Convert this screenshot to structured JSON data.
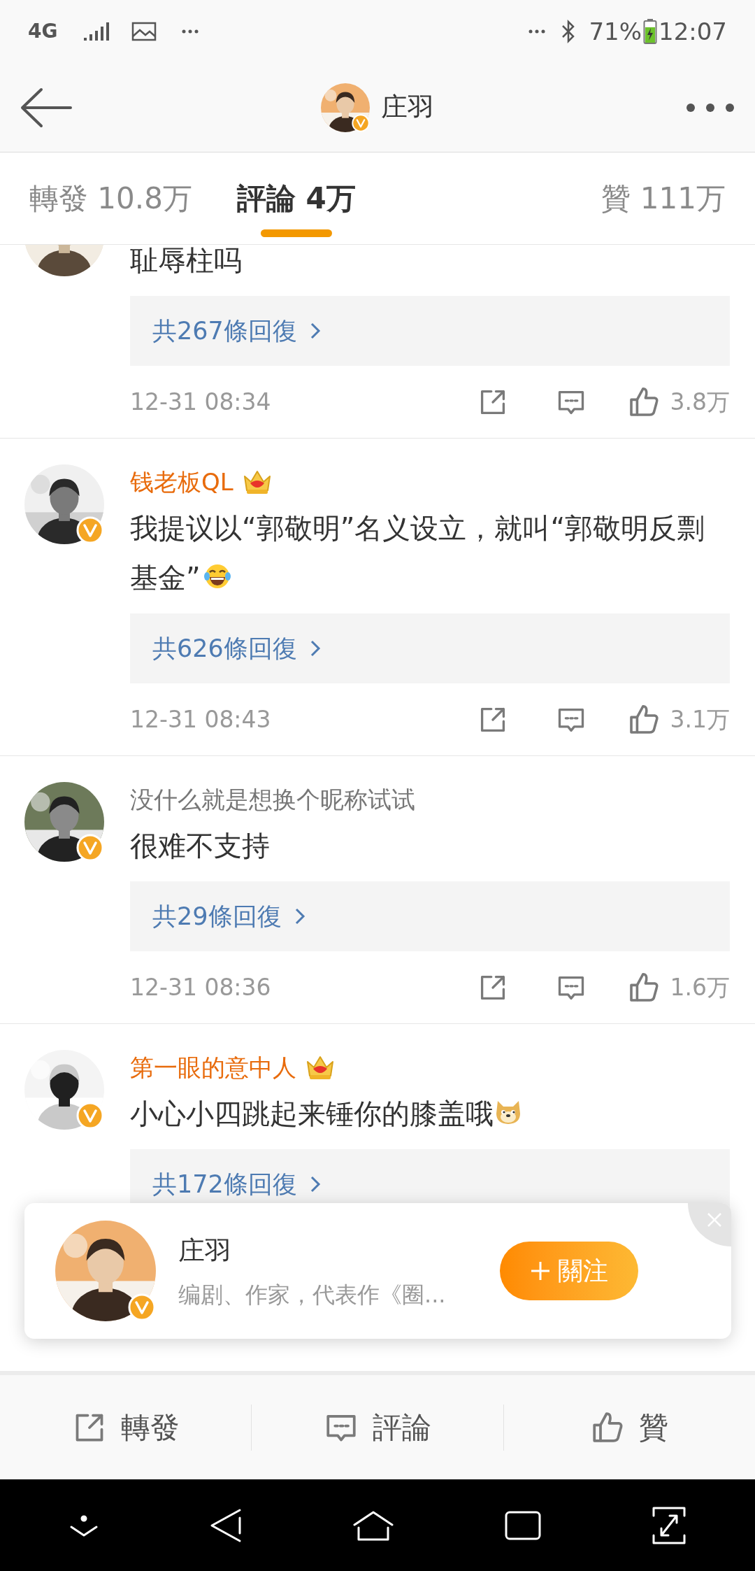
{
  "status_bar": {
    "network": "4G",
    "battery": "71%",
    "time": "12:07"
  },
  "header": {
    "title": "庄羽",
    "verified": true
  },
  "tabs": [
    {
      "label": "轉發",
      "count": "10.8万",
      "selected": false
    },
    {
      "label": "評論",
      "count": "4万",
      "selected": true
    },
    {
      "label": "贊",
      "count": "111万",
      "selected": false
    }
  ],
  "comments": [
    {
      "text": "耻辱柱吗",
      "replies": "共267條回復",
      "date": "12-31 08:34",
      "likes": "3.8万"
    },
    {
      "name": "钱老板QL",
      "vip": true,
      "verified": true,
      "text": "我提议以“郭敬明”名义设立，就叫“郭敬明反剽基金”",
      "replies": "共626條回復",
      "date": "12-31 08:43",
      "likes": "3.1万"
    },
    {
      "name": "没什么就是想换个昵称试试",
      "vip": false,
      "verified": true,
      "text": "很难不支持",
      "replies": "共29條回復",
      "date": "12-31 08:36",
      "likes": "1.6万"
    },
    {
      "name": "第一眼的意中人",
      "vip": true,
      "verified": true,
      "text": "小心小四跳起来锤你的膝盖哦",
      "replies": "共172條回復"
    }
  ],
  "follow_card": {
    "name": "庄羽",
    "verified": true,
    "bio": "编剧、作家，代表作《圈...",
    "button": "關注"
  },
  "bottom_bar": [
    {
      "kind": "repost",
      "label": "轉發"
    },
    {
      "kind": "comment",
      "label": "評論"
    },
    {
      "kind": "like",
      "label": "贊"
    }
  ]
}
